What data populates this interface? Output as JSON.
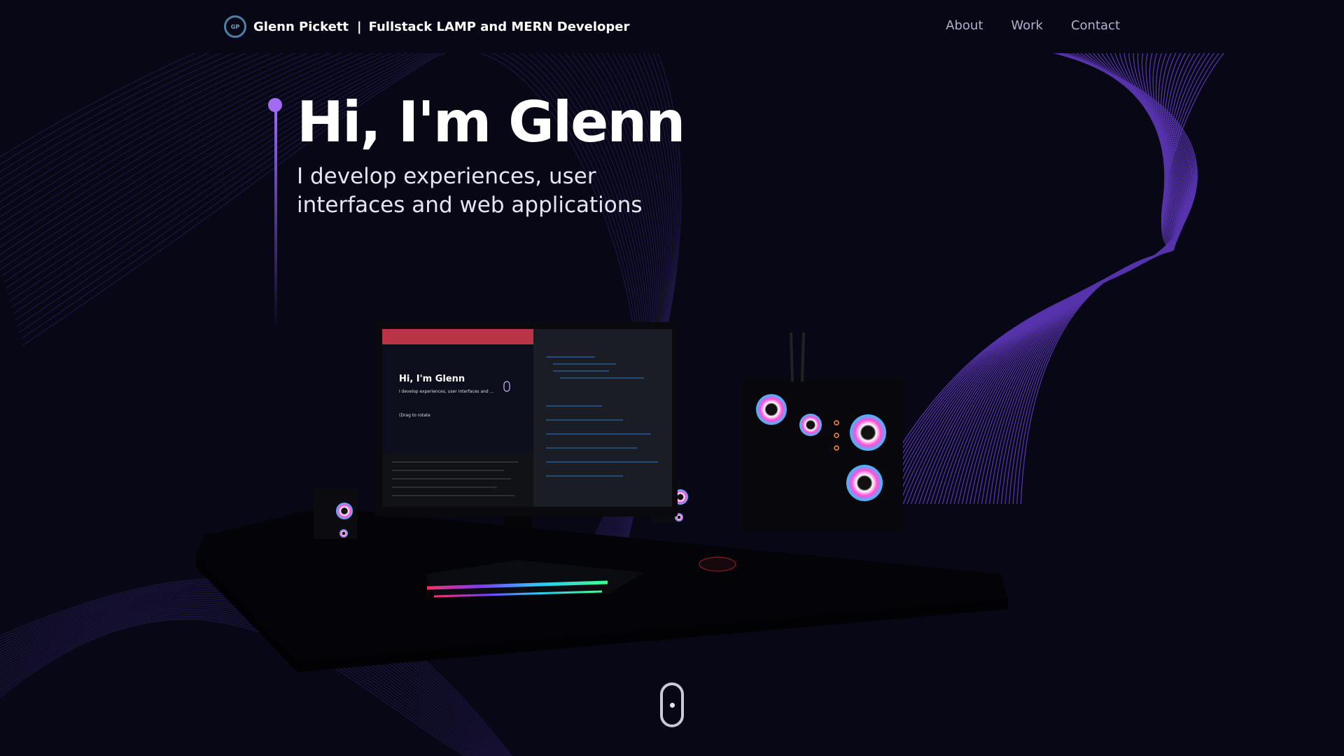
{
  "brand": {
    "logo_text": "GP",
    "name": "Glenn Pickett",
    "separator": "|",
    "role": "Fullstack LAMP and MERN Developer"
  },
  "nav": {
    "items": [
      {
        "label": "About"
      },
      {
        "label": "Work"
      },
      {
        "label": "Contact"
      }
    ]
  },
  "hero": {
    "title": "Hi, I'm Glenn",
    "subtitle": "I develop experiences, user interfaces and web applications"
  },
  "scene": {
    "screen_title": "Hi, I'm Glenn",
    "screen_sub": "I develop experiences, user interfaces and ...",
    "screen_hint": "(Drag to rotate"
  },
  "colors": {
    "background": "#070716",
    "accent": "#a26cf2",
    "wave": "#6a3fd0",
    "nav_link": "#aeb3c7"
  }
}
